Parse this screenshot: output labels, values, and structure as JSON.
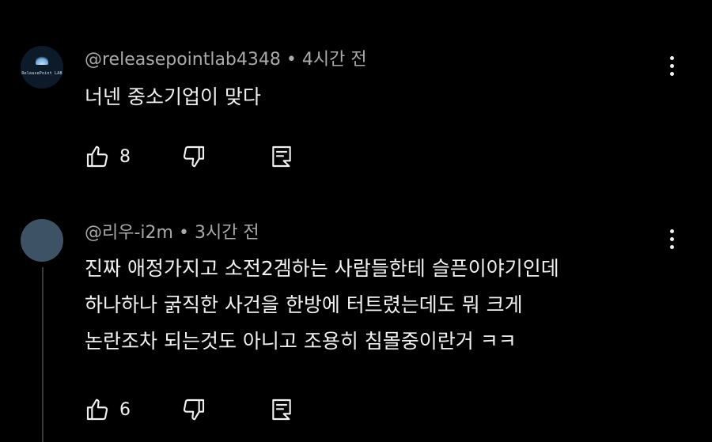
{
  "comments": [
    {
      "author": "@releasepointlab4348",
      "separator": "•",
      "time": "4시간 전",
      "avatar_text": "ReleasePoint LAB",
      "lines": [
        "너넨 중소기업이 맞다"
      ],
      "likes": "8"
    },
    {
      "author": "@리우-i2m",
      "separator": "•",
      "time": "3시간 전",
      "lines": [
        "진짜 애정가지고 소전2겜하는 사람들한테 슬픈이야기인데",
        "하나하나 굵직한 사건을 한방에 터트렸는데도 뭐 크게",
        "논란조차 되는것도 아니고 조용히 침몰중이란거 ㅋㅋ"
      ],
      "likes": "6"
    }
  ],
  "colors": {
    "background": "#000000",
    "text": "#f1f1f1",
    "meta_text": "#aaaaaa",
    "thread_line": "#3a3a3a"
  },
  "icons": [
    "thumbs-up-icon",
    "thumbs-down-icon",
    "reply-icon",
    "more-vert-icon"
  ]
}
